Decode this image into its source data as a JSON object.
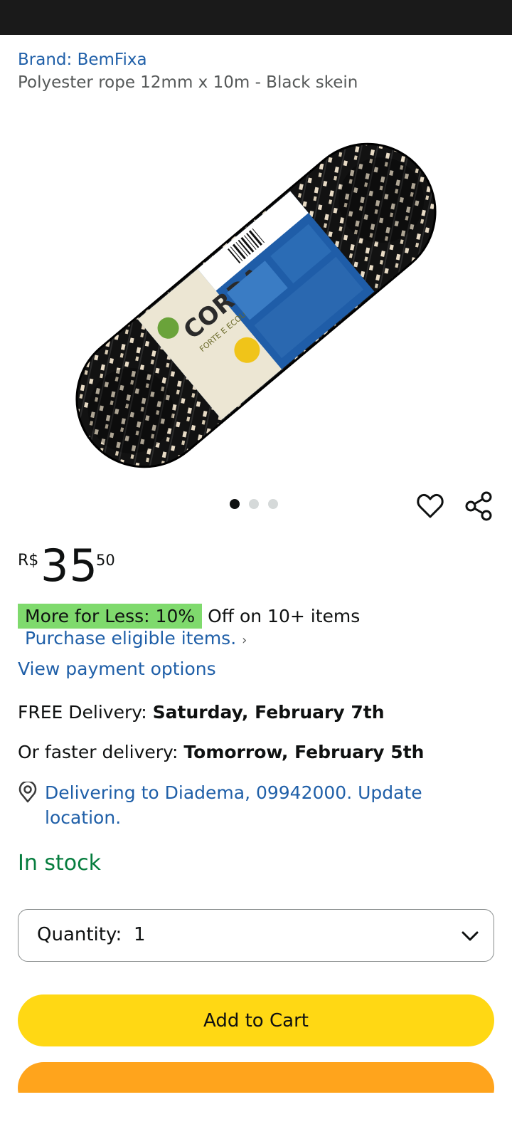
{
  "product": {
    "brand_link": "Brand: BemFixa",
    "title": "Polyester rope 12mm x 10m - Black skein"
  },
  "gallery": {
    "pages": 3,
    "active_index": 0,
    "label_text": "CORDA",
    "label_subtext": "FORTE E ECOLÓGICA"
  },
  "price": {
    "currency": "R$",
    "whole": "35",
    "fraction": "50"
  },
  "promo": {
    "badge": "More for Less: 10%",
    "rest": "Off on 10+ items",
    "eligible_link": "Purchase eligible items.",
    "eligible_chevron": "›"
  },
  "payment_link": "View payment options",
  "delivery": {
    "free_prefix": "FREE Delivery: ",
    "free_date": "Saturday, February 7th",
    "faster_prefix": "Or faster delivery: ",
    "faster_date": "Tomorrow, February 5th",
    "location": "Delivering to Diadema, 09942000. Update location."
  },
  "stock": "In stock",
  "quantity": {
    "label": "Quantity:",
    "value": "1"
  },
  "buttons": {
    "add_to_cart": "Add to Cart"
  },
  "colors": {
    "link": "#1f5fa8",
    "in_stock": "#067d3e",
    "promo_badge": "#7fda6d",
    "add_to_cart": "#ffd814",
    "buy_now": "#ffa41c"
  }
}
